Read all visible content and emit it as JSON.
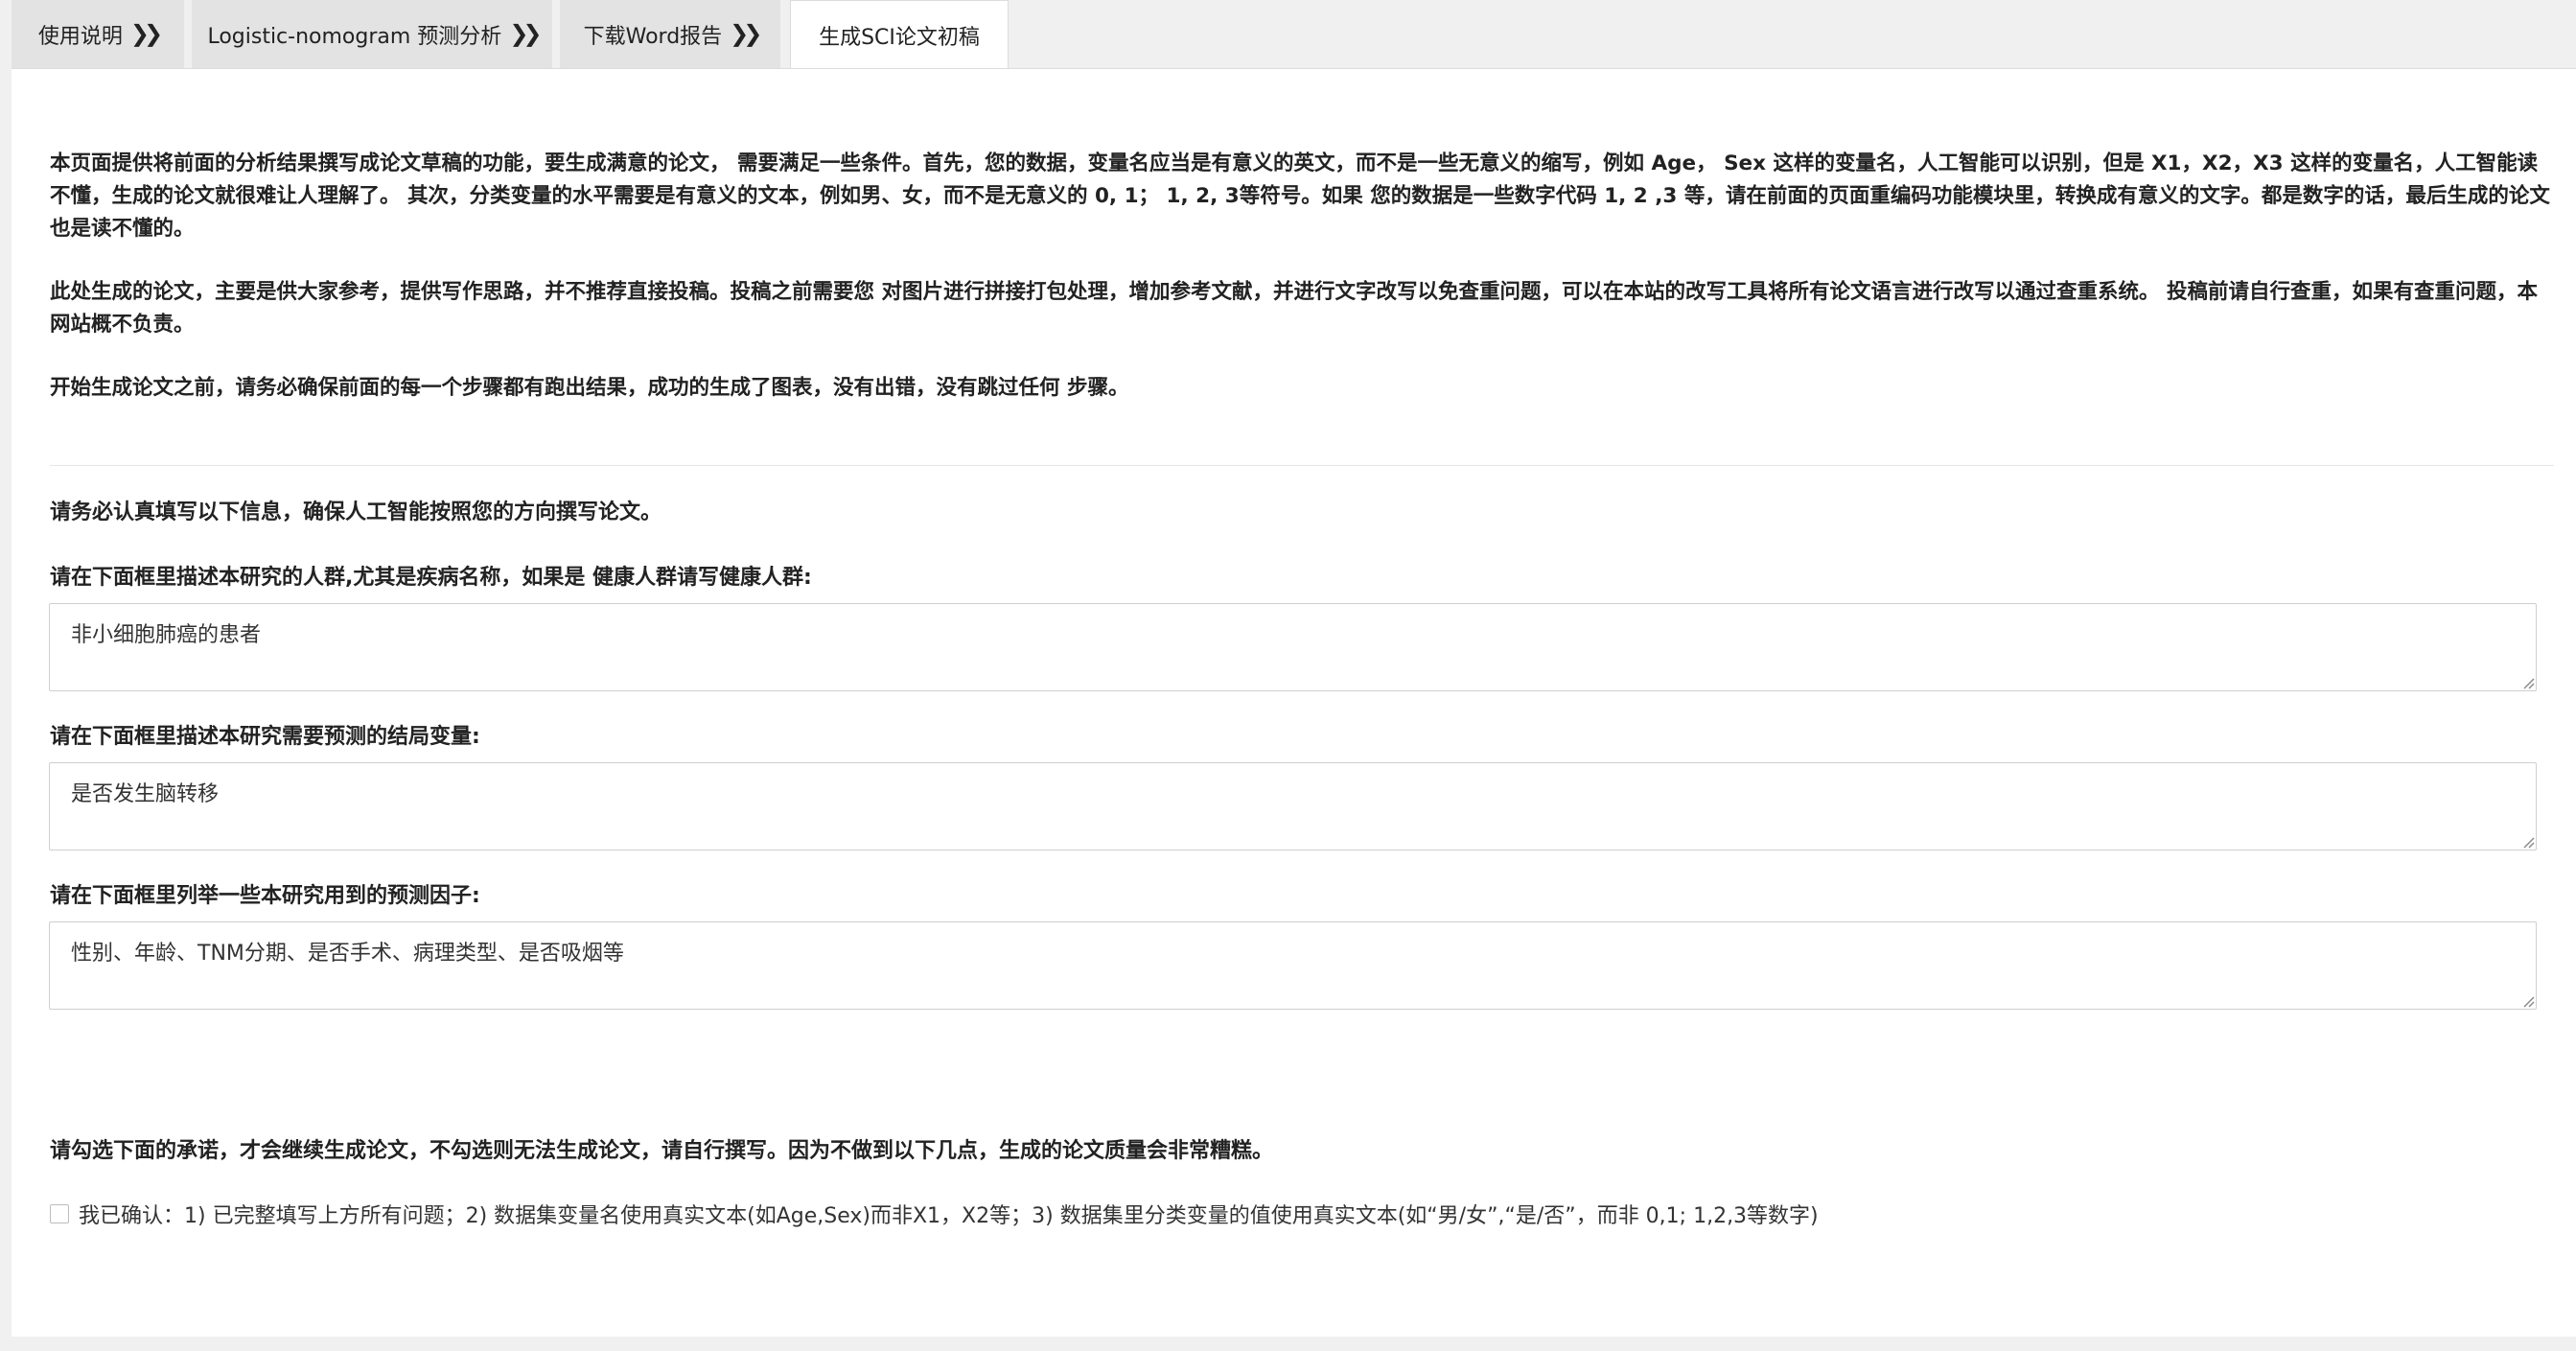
{
  "tabs": [
    {
      "label": "使用说明",
      "chevron": true,
      "active": false
    },
    {
      "label": "Logistic-nomogram 预测分析",
      "chevron": true,
      "active": false
    },
    {
      "label": "下载Word报告",
      "chevron": true,
      "active": false
    },
    {
      "label": "生成SCI论文初稿",
      "chevron": false,
      "active": true
    }
  ],
  "intro": {
    "p1": "本页面提供将前面的分析结果撰写成论文草稿的功能，要生成满意的论文， 需要满足一些条件。首先，您的数据，变量名应当是有意义的英文，而不是一些无意义的缩写，例如 Age， Sex 这样的变量名，人工智能可以识别，但是 X1，X2，X3 这样的变量名，人工智能读不懂，生成的论文就很难让人理解了。 其次，分类变量的水平需要是有意义的文本，例如男、女，而不是无意义的 0, 1； 1, 2, 3等符号。如果 您的数据是一些数字代码 1, 2 ,3 等，请在前面的页面重编码功能模块里，转换成有意义的文字。都是数字的话，最后生成的论文也是读不懂的。",
    "p2": "此处生成的论文，主要是供大家参考，提供写作思路，并不推荐直接投稿。投稿之前需要您 对图片进行拼接打包处理，增加参考文献，并进行文字改写以免查重问题，可以在本站的改写工具将所有论文语言进行改写以通过查重系统。 投稿前请自行查重，如果有查重问题，本网站概不负责。",
    "p3": "开始生成论文之前，请务必确保前面的每一个步骤都有跑出结果，成功的生成了图表，没有出错，没有跳过任何 步骤。"
  },
  "form": {
    "instruction": "请务必认真填写以下信息，确保人工智能按照您的方向撰写论文。",
    "population_label": "请在下面框里描述本研究的人群,尤其是疾病名称，如果是 健康人群请写健康人群:",
    "population_value": "非小细胞肺癌的患者",
    "outcome_label": "请在下面框里描述本研究需要预测的结局变量:",
    "outcome_value": "是否发生脑转移",
    "predictors_label": "请在下面框里列举一些本研究用到的预测因子:",
    "predictors_value": "性别、年龄、TNM分期、是否手术、病理类型、是否吸烟等"
  },
  "commitment": {
    "heading": "请勾选下面的承诺，才会继续生成论文，不勾选则无法生成论文，请自行撰写。因为不做到以下几点，生成的论文质量会非常糟糕。",
    "checkbox_label": "我已确认：1) 已完整填写上方所有问题；2) 数据集变量名使用真实文本(如Age,Sex)而非X1，X2等；3) 数据集里分类变量的值使用真实文本(如“男/女”,“是/否”，而非 0,1; 1,2,3等数字)",
    "checked": false
  },
  "icons": {
    "tab_chevron": "double-chevron-right-icon",
    "resize_grip": "resize-grip-icon"
  },
  "colors": {
    "tab_bg": "#e3e3e3",
    "tab_active_bg": "#ffffff",
    "page_bg": "#f0f0f0",
    "text": "#222222"
  }
}
